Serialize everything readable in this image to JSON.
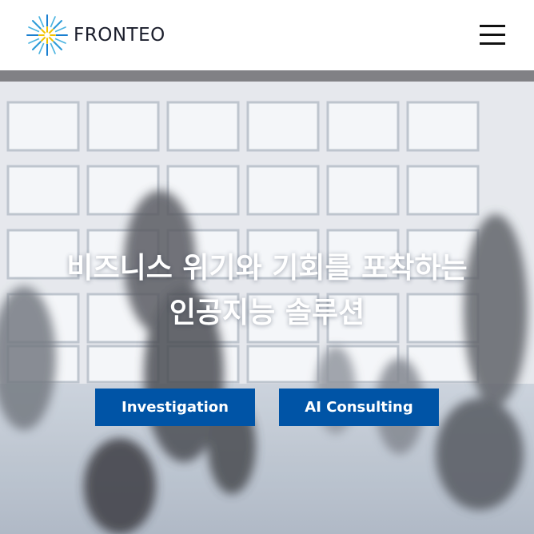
{
  "header": {
    "logo_text": "FRONTEO",
    "menu_icon": "hamburger-menu-icon"
  },
  "hero": {
    "headline_line1": "비즈니스 위기와 기회를 포착하는",
    "headline_line2": "인공지능 솔루션",
    "buttons": [
      {
        "label": "Investigation"
      },
      {
        "label": "AI Consulting"
      }
    ]
  },
  "colors": {
    "button_bg": "#0054a6",
    "logo_yellow": "#f2c200",
    "logo_blue": "#1a7fd0"
  }
}
